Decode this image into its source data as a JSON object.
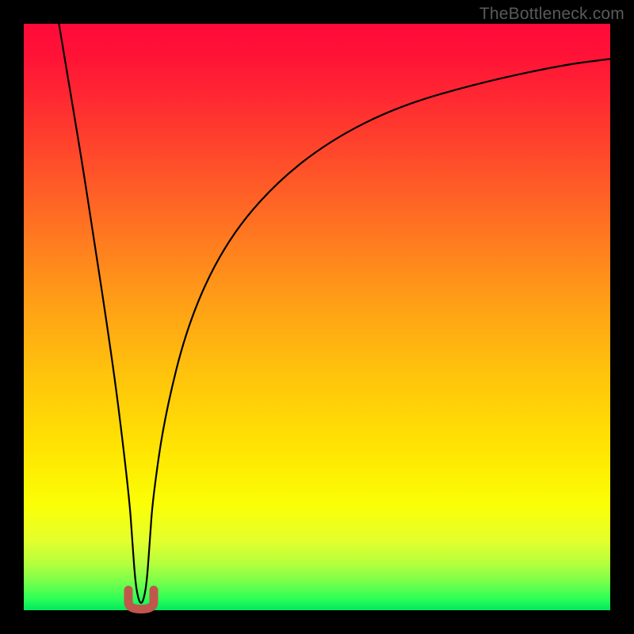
{
  "watermark": "TheBottleneck.com",
  "chart_data": {
    "type": "line",
    "title": "",
    "xlabel": "",
    "ylabel": "",
    "xlim": [
      0,
      100
    ],
    "ylim": [
      0,
      100
    ],
    "grid": false,
    "legend": false,
    "series": [
      {
        "name": "bottleneck-curve",
        "x": [
          6,
          8,
          10,
          12,
          14,
          16,
          18,
          18.5,
          19,
          19.5,
          20,
          20.5,
          21,
          21.5,
          22,
          24,
          28,
          34,
          42,
          52,
          64,
          78,
          92,
          100
        ],
        "y": [
          100,
          88,
          76,
          63,
          50,
          36,
          19,
          12,
          5,
          2,
          1,
          2,
          5,
          12,
          19,
          33,
          49,
          62,
          72,
          80,
          86,
          90,
          93,
          94
        ]
      }
    ],
    "marker": {
      "name": "minimum-marker",
      "shape": "U",
      "color": "#c1564c",
      "x": 20,
      "y": 1
    },
    "colors": {
      "curve": "#000000",
      "gradient_top": "#ff0a3a",
      "gradient_bottom": "#00e85e",
      "frame": "#000000",
      "marker": "#c1564c"
    }
  }
}
